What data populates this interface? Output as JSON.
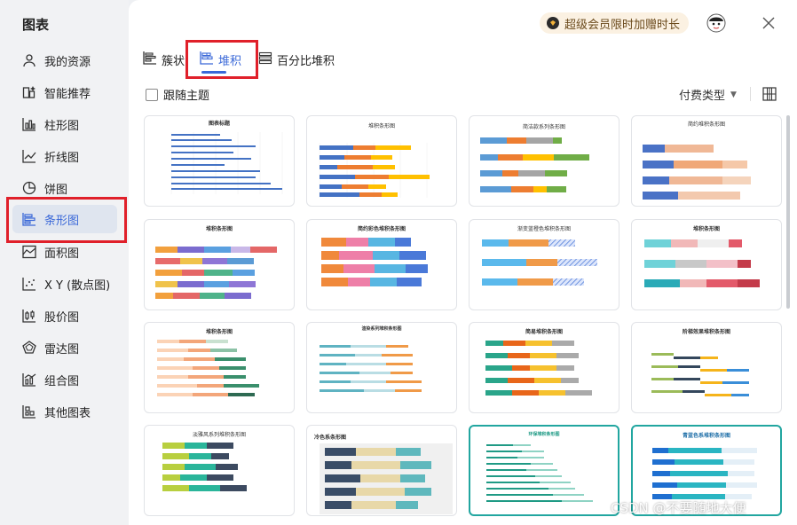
{
  "sidebar": {
    "title": "图表",
    "items": [
      {
        "label": "我的资源",
        "icon": "user-icon"
      },
      {
        "label": "智能推荐",
        "icon": "smart-recommend-icon"
      },
      {
        "label": "柱形图",
        "icon": "column-chart-icon"
      },
      {
        "label": "折线图",
        "icon": "line-chart-icon"
      },
      {
        "label": "饼图",
        "icon": "pie-chart-icon"
      },
      {
        "label": "条形图",
        "icon": "bar-chart-icon",
        "active": true
      },
      {
        "label": "面积图",
        "icon": "area-chart-icon"
      },
      {
        "label": "X Y (散点图)",
        "icon": "scatter-chart-icon"
      },
      {
        "label": "股价图",
        "icon": "stock-chart-icon"
      },
      {
        "label": "雷达图",
        "icon": "radar-chart-icon"
      },
      {
        "label": "组合图",
        "icon": "combo-chart-icon"
      },
      {
        "label": "其他图表",
        "icon": "other-chart-icon"
      }
    ]
  },
  "header": {
    "promo_text": "超级会员限时加赠时长",
    "close_icon": "close-icon",
    "avatar_icon": "avatar-icon"
  },
  "tabs": [
    {
      "label": "簇状",
      "icon": "clustered-bar-icon"
    },
    {
      "label": "堆积",
      "icon": "stacked-bar-icon",
      "active": true
    },
    {
      "label": "百分比堆积",
      "icon": "percent-stacked-bar-icon"
    }
  ],
  "toolbar": {
    "follow_theme_label": "跟随主题",
    "follow_theme_checked": false,
    "pay_type_label": "付费类型",
    "grid_view_icon": "grid-view-icon"
  },
  "templates": [
    {
      "title": "图表标题"
    },
    {
      "title": "堆积条形图"
    },
    {
      "title": "简洁款系列条形图"
    },
    {
      "title": "简约堆积条形图"
    },
    {
      "title": "堆积条形图"
    },
    {
      "title": "简约彩色堆积条形图"
    },
    {
      "title": "渐变蓝橙色堆积条形图"
    },
    {
      "title": "堆积条形图"
    },
    {
      "title": "堆积条形图"
    },
    {
      "title": "渲染系列堆积条形图"
    },
    {
      "title": "简易堆积条形图"
    },
    {
      "title": "阶梯效果堆积条形图"
    },
    {
      "title": "淡雅风系列堆积条形图"
    },
    {
      "title": "冷色系条形图"
    },
    {
      "title": "环保堆积条形图"
    },
    {
      "title": "青蓝色系堆积条形图"
    }
  ],
  "watermark": "CSDN @不要随地大便",
  "colors": {
    "accent": "#3a68d8",
    "highlight_red": "#e0202a",
    "teal_border": "#22a6a0"
  }
}
